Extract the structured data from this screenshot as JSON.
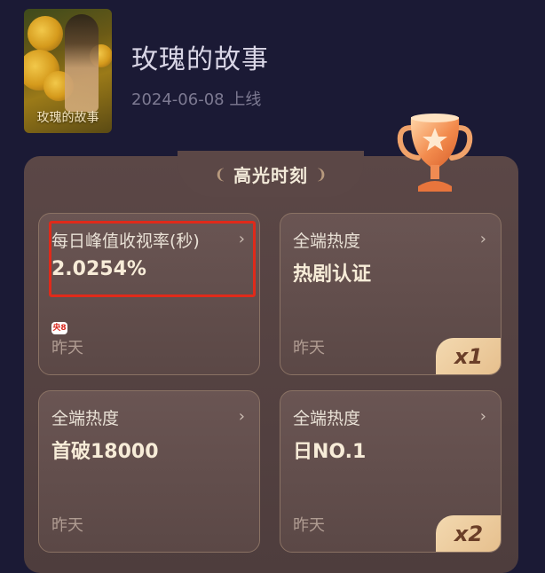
{
  "show": {
    "poster_text": "玫瑰的故事",
    "title": "玫瑰的故事",
    "date": "2024-06-08 上线"
  },
  "highlights": {
    "header": "高光时刻",
    "cards": [
      {
        "label": "每日峰值收视率(秒)",
        "value": "2.0254%",
        "time": "昨天",
        "channel_logo": "央8",
        "badge": ""
      },
      {
        "label": "全端热度",
        "value": "热剧认证",
        "time": "昨天",
        "badge": "x1"
      },
      {
        "label": "全端热度",
        "value": "首破18000",
        "time": "昨天",
        "badge": ""
      },
      {
        "label": "全端热度",
        "value": "日NO.1",
        "time": "昨天",
        "badge": "x2"
      }
    ]
  },
  "icons": {
    "chevron": "chevron-right-icon",
    "trophy": "trophy-icon",
    "laurel": "laurel-icon"
  },
  "colors": {
    "background": "#1b1a35",
    "panel": "#5b4746",
    "card_border": "#8a7264",
    "badge": "#f3d9b0",
    "highlight": "#e02a1a"
  }
}
